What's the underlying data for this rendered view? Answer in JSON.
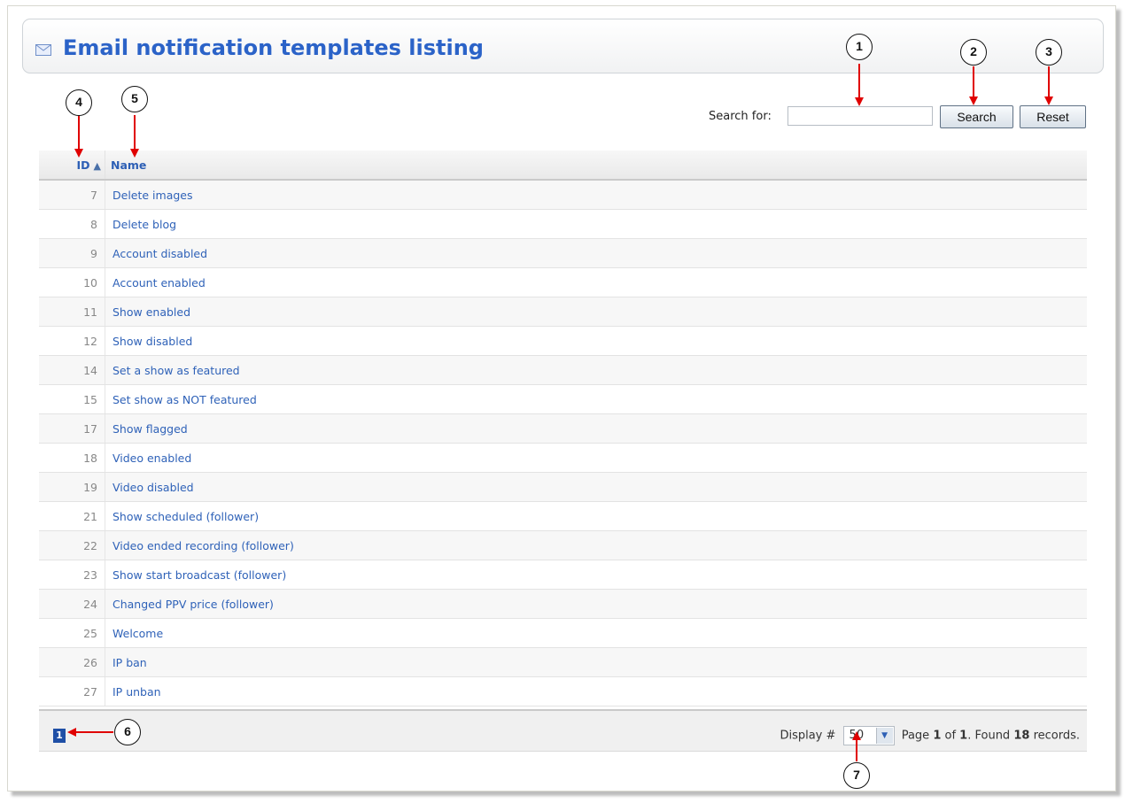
{
  "page": {
    "title": "Email notification templates listing",
    "title_icon": "envelope-icon"
  },
  "search": {
    "label": "Search for:",
    "value": "",
    "search_button": "Search",
    "reset_button": "Reset"
  },
  "table": {
    "columns": [
      "ID",
      "Name"
    ],
    "sort_column": "ID",
    "sort_direction": "ascending",
    "rows": [
      {
        "id": "7",
        "name": "Delete images"
      },
      {
        "id": "8",
        "name": "Delete blog"
      },
      {
        "id": "9",
        "name": "Account disabled"
      },
      {
        "id": "10",
        "name": "Account enabled"
      },
      {
        "id": "11",
        "name": "Show enabled"
      },
      {
        "id": "12",
        "name": "Show disabled"
      },
      {
        "id": "14",
        "name": "Set a show as featured"
      },
      {
        "id": "15",
        "name": "Set show as NOT featured"
      },
      {
        "id": "17",
        "name": "Show flagged"
      },
      {
        "id": "18",
        "name": "Video enabled"
      },
      {
        "id": "19",
        "name": "Video disabled"
      },
      {
        "id": "21",
        "name": "Show scheduled (follower)"
      },
      {
        "id": "22",
        "name": "Video ended recording (follower)"
      },
      {
        "id": "23",
        "name": "Show start broadcast (follower)"
      },
      {
        "id": "24",
        "name": "Changed PPV price (follower)"
      },
      {
        "id": "25",
        "name": "Welcome"
      },
      {
        "id": "26",
        "name": "IP ban"
      },
      {
        "id": "27",
        "name": "IP unban"
      }
    ]
  },
  "pagination": {
    "current_page": "1",
    "display_label": "Display #",
    "display_value": "50",
    "page_text": "Page",
    "page_current": "1",
    "of_text": "of",
    "page_total": "1",
    "found_text": ". Found",
    "record_count": "18",
    "records_text": "records."
  },
  "annotations": [
    "1",
    "2",
    "3",
    "4",
    "5",
    "6",
    "7"
  ],
  "colors": {
    "title": "#2b63c8",
    "link": "#2f62b8",
    "annotation_arrow": "#e00000",
    "page_button": "#1f4fa6"
  }
}
